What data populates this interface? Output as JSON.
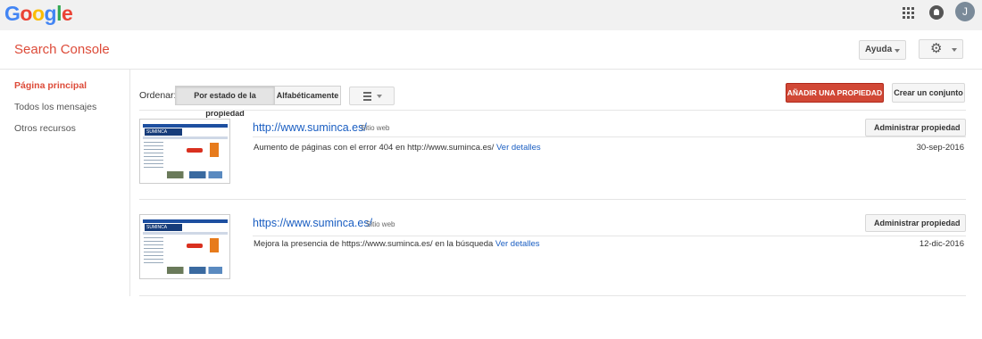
{
  "topbar": {
    "logo_letters": [
      "G",
      "o",
      "o",
      "g",
      "l",
      "e"
    ],
    "apps_icon": "apps-grid-icon",
    "notifications_icon": "notifications-icon",
    "avatar_initial": "J"
  },
  "header": {
    "title": "Search Console",
    "help_label": "Ayuda",
    "settings_icon": "gear-icon"
  },
  "sidebar": {
    "items": [
      {
        "label": "Página principal",
        "active": true
      },
      {
        "label": "Todos los mensajes",
        "active": false
      },
      {
        "label": "Otros recursos",
        "active": false
      }
    ]
  },
  "toolbar": {
    "sort_label": "Ordenar:",
    "sort_by_status": "Por estado de la propiedad",
    "sort_alpha": "Alfabéticamente",
    "view_icon": "list-view-icon",
    "add_property": "AÑADIR UNA PROPIEDAD",
    "create_set": "Crear un conjunto"
  },
  "properties": [
    {
      "url": "http://www.suminca.es/",
      "type": "Sitio web",
      "manage_label": "Administrar propiedad",
      "message": "Aumento de páginas con el error 404 en http://www.suminca.es/",
      "details_link": "Ver detalles",
      "date": "30-sep-2016",
      "thumb_logo": "SUMINCA"
    },
    {
      "url": "https://www.suminca.es/",
      "type": "Sitio web",
      "manage_label": "Administrar propiedad",
      "message": "Mejora la presencia de https://www.suminca.es/ en la búsqueda",
      "details_link": "Ver detalles",
      "date": "12-dic-2016",
      "thumb_logo": "SUMINCA"
    }
  ],
  "colors": {
    "brand_red": "#dd4b39",
    "primary_button": "#d14836",
    "link_blue": "#1a5ec2"
  }
}
